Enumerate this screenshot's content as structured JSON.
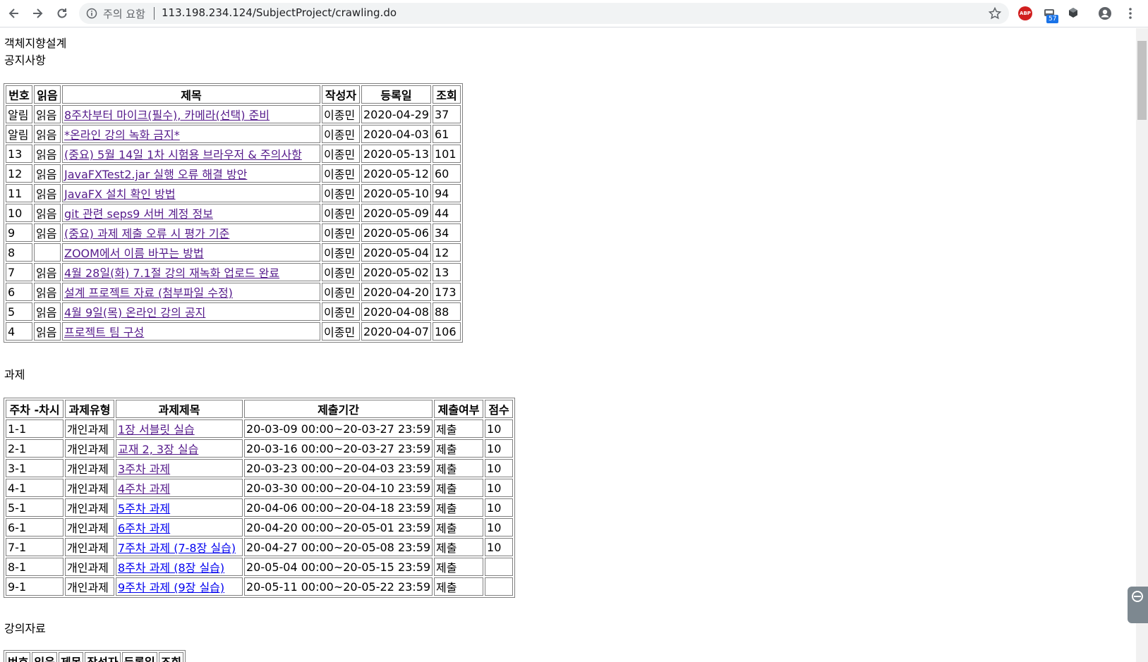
{
  "browser": {
    "security_warning": "주의 요함",
    "url": "113.198.234.124/SubjectProject/crawling.do",
    "abp_label": "ABP",
    "extension_badge": "57"
  },
  "page": {
    "course_title": "객체지향설계",
    "notice_heading": "공지사항",
    "assignment_heading": "과제",
    "material_heading": "강의자료"
  },
  "notices": {
    "headers": [
      "번호",
      "읽음",
      "제목",
      "작성자",
      "등록일",
      "조회"
    ],
    "rows": [
      {
        "num": "알림",
        "read": "읽음",
        "title": "8주차부터 마이크(필수), 카메라(선택) 준비",
        "author": "이종민",
        "date": "2020-04-29",
        "views": "37"
      },
      {
        "num": "알림",
        "read": "읽음",
        "title": "*온라인 강의 녹화 금지*",
        "author": "이종민",
        "date": "2020-04-03",
        "views": "61"
      },
      {
        "num": "13",
        "read": "읽음",
        "title": "(중요) 5월 14일 1차 시험용 브라우저 & 주의사항",
        "author": "이종민",
        "date": "2020-05-13",
        "views": "101"
      },
      {
        "num": "12",
        "read": "읽음",
        "title": "JavaFXTest2.jar 실행 오류 해결 방안",
        "author": "이종민",
        "date": "2020-05-12",
        "views": "60"
      },
      {
        "num": "11",
        "read": "읽음",
        "title": "JavaFX 설치 확인 방법",
        "author": "이종민",
        "date": "2020-05-10",
        "views": "94"
      },
      {
        "num": "10",
        "read": "읽음",
        "title": "git 관련 seps9 서버 계정 정보",
        "author": "이종민",
        "date": "2020-05-09",
        "views": "44"
      },
      {
        "num": "9",
        "read": "읽음",
        "title": "(중요) 과제 제출 오류 시 평가 기준",
        "author": "이종민",
        "date": "2020-05-06",
        "views": "34"
      },
      {
        "num": "8",
        "read": "",
        "title": "ZOOM에서 이름 바꾸는 방법",
        "author": "이종민",
        "date": "2020-05-04",
        "views": "12"
      },
      {
        "num": "7",
        "read": "읽음",
        "title": "4월 28일(화) 7.1절 강의 재녹화 업로드 완료",
        "author": "이종민",
        "date": "2020-05-02",
        "views": "13"
      },
      {
        "num": "6",
        "read": "읽음",
        "title": "설계 프로젝트 자료 (첨부파일 수정)",
        "author": "이종민",
        "date": "2020-04-20",
        "views": "173"
      },
      {
        "num": "5",
        "read": "읽음",
        "title": "4월 9일(목) 온라인 강의 공지",
        "author": "이종민",
        "date": "2020-04-08",
        "views": "88"
      },
      {
        "num": "4",
        "read": "읽음",
        "title": "프로젝트 팀 구성",
        "author": "이종민",
        "date": "2020-04-07",
        "views": "106"
      }
    ]
  },
  "assignments": {
    "headers": [
      "주차 -차시",
      "과제유형",
      "과제제목",
      "제출기간",
      "제출여부",
      "점수"
    ],
    "rows": [
      {
        "week": "1-1",
        "type": "개인과제",
        "title": "1장 서블릿 실습",
        "period": "20-03-09 00:00~20-03-27 23:59",
        "submitted": "제출",
        "score": "10",
        "visited": true
      },
      {
        "week": "2-1",
        "type": "개인과제",
        "title": "교재 2, 3장 실습",
        "period": "20-03-16 00:00~20-03-27 23:59",
        "submitted": "제출",
        "score": "10",
        "visited": true
      },
      {
        "week": "3-1",
        "type": "개인과제",
        "title": "3주차 과제",
        "period": "20-03-23 00:00~20-04-03 23:59",
        "submitted": "제출",
        "score": "10",
        "visited": true
      },
      {
        "week": "4-1",
        "type": "개인과제",
        "title": "4주차 과제",
        "period": "20-03-30 00:00~20-04-10 23:59",
        "submitted": "제출",
        "score": "10",
        "visited": true
      },
      {
        "week": "5-1",
        "type": "개인과제",
        "title": "5주차 과제",
        "period": "20-04-06 00:00~20-04-18 23:59",
        "submitted": "제출",
        "score": "10",
        "visited": false
      },
      {
        "week": "6-1",
        "type": "개인과제",
        "title": "6주차 과제",
        "period": "20-04-20 00:00~20-05-01 23:59",
        "submitted": "제출",
        "score": "10",
        "visited": false
      },
      {
        "week": "7-1",
        "type": "개인과제",
        "title": "7주차 과제 (7-8장 실습)",
        "period": "20-04-27 00:00~20-05-08 23:59",
        "submitted": "제출",
        "score": "10",
        "visited": false
      },
      {
        "week": "8-1",
        "type": "개인과제",
        "title": "8주차 과제 (8장 실습)",
        "period": "20-05-04 00:00~20-05-15 23:59",
        "submitted": "제출",
        "score": "",
        "visited": false
      },
      {
        "week": "9-1",
        "type": "개인과제",
        "title": "9주차 과제 (9장 실습)",
        "period": "20-05-11 00:00~20-05-22 23:59",
        "submitted": "제출",
        "score": "",
        "visited": false
      }
    ]
  },
  "materials": {
    "headers": [
      "번호",
      "읽음",
      "제목",
      "작성자",
      "등록일",
      "조회"
    ]
  },
  "colors": {
    "visited_link": "#551a8b",
    "unvisited_link": "#0000ee",
    "omnibox_bg": "#f1f3f4"
  }
}
